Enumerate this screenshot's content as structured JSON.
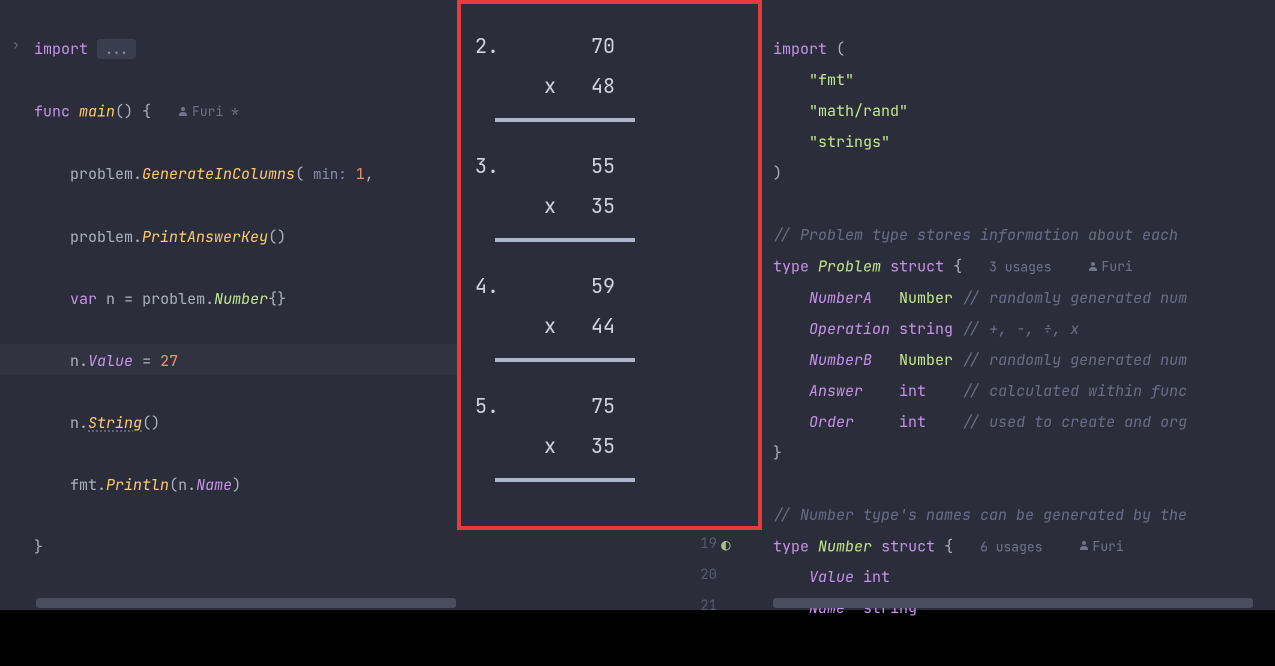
{
  "left": {
    "import_kw": "import",
    "import_ellipsis": "...",
    "func_kw": "func",
    "main_name": "main",
    "author_name": "Furi *",
    "l1_obj": "problem",
    "l1_method": "GenerateInColumns",
    "l1_hint": "min:",
    "l1_val": "1",
    "l2_obj": "problem",
    "l2_method": "PrintAnswerKey",
    "var_kw": "var",
    "var_name": "n",
    "var_pkg": "problem",
    "var_type": "Number",
    "assign_lhs_obj": "n",
    "assign_lhs_prop": "Value",
    "assign_val": "27",
    "call_obj": "n",
    "call_method": "String",
    "print_pkg": "fmt",
    "print_fn": "Println",
    "print_arg_obj": "n",
    "print_arg_prop": "Name"
  },
  "problems": [
    {
      "order": "2.",
      "a": "70",
      "op": "x",
      "b": "48"
    },
    {
      "order": "3.",
      "a": "55",
      "op": "x",
      "b": "35"
    },
    {
      "order": "4.",
      "a": "59",
      "op": "x",
      "b": "44"
    },
    {
      "order": "5.",
      "a": "75",
      "op": "x",
      "b": "35"
    }
  ],
  "right": {
    "import_kw": "import",
    "imp1": "\"fmt\"",
    "imp2": "\"math/rand\"",
    "imp3": "\"strings\"",
    "comment_problem": "// Problem type stores information about each ",
    "type_kw": "type",
    "problem_name": "Problem",
    "struct_kw": "struct",
    "problem_usages": "3 usages",
    "author": "Furi",
    "f_numA": "NumberA",
    "t_numA": "Number",
    "c_numA": "// randomly generated num",
    "f_op": "Operation",
    "t_op": "string",
    "c_op": "// +, -, ÷, x",
    "f_numB": "NumberB",
    "t_numB": "Number",
    "c_numB": "// randomly generated num",
    "f_ans": "Answer",
    "t_ans": "int",
    "c_ans": "// calculated within func",
    "f_ord": "Order",
    "t_ord": "int",
    "c_ord": "// used to create and org",
    "comment_number": "// Number type's names can be generated by the",
    "number_name": "Number",
    "number_usages": "6 usages",
    "nf_val": "Value",
    "nt_val": "int",
    "nf_name": "Name",
    "nt_name": "string",
    "gutter": {
      "g19": "19",
      "g20": "20",
      "g21": "21"
    }
  }
}
